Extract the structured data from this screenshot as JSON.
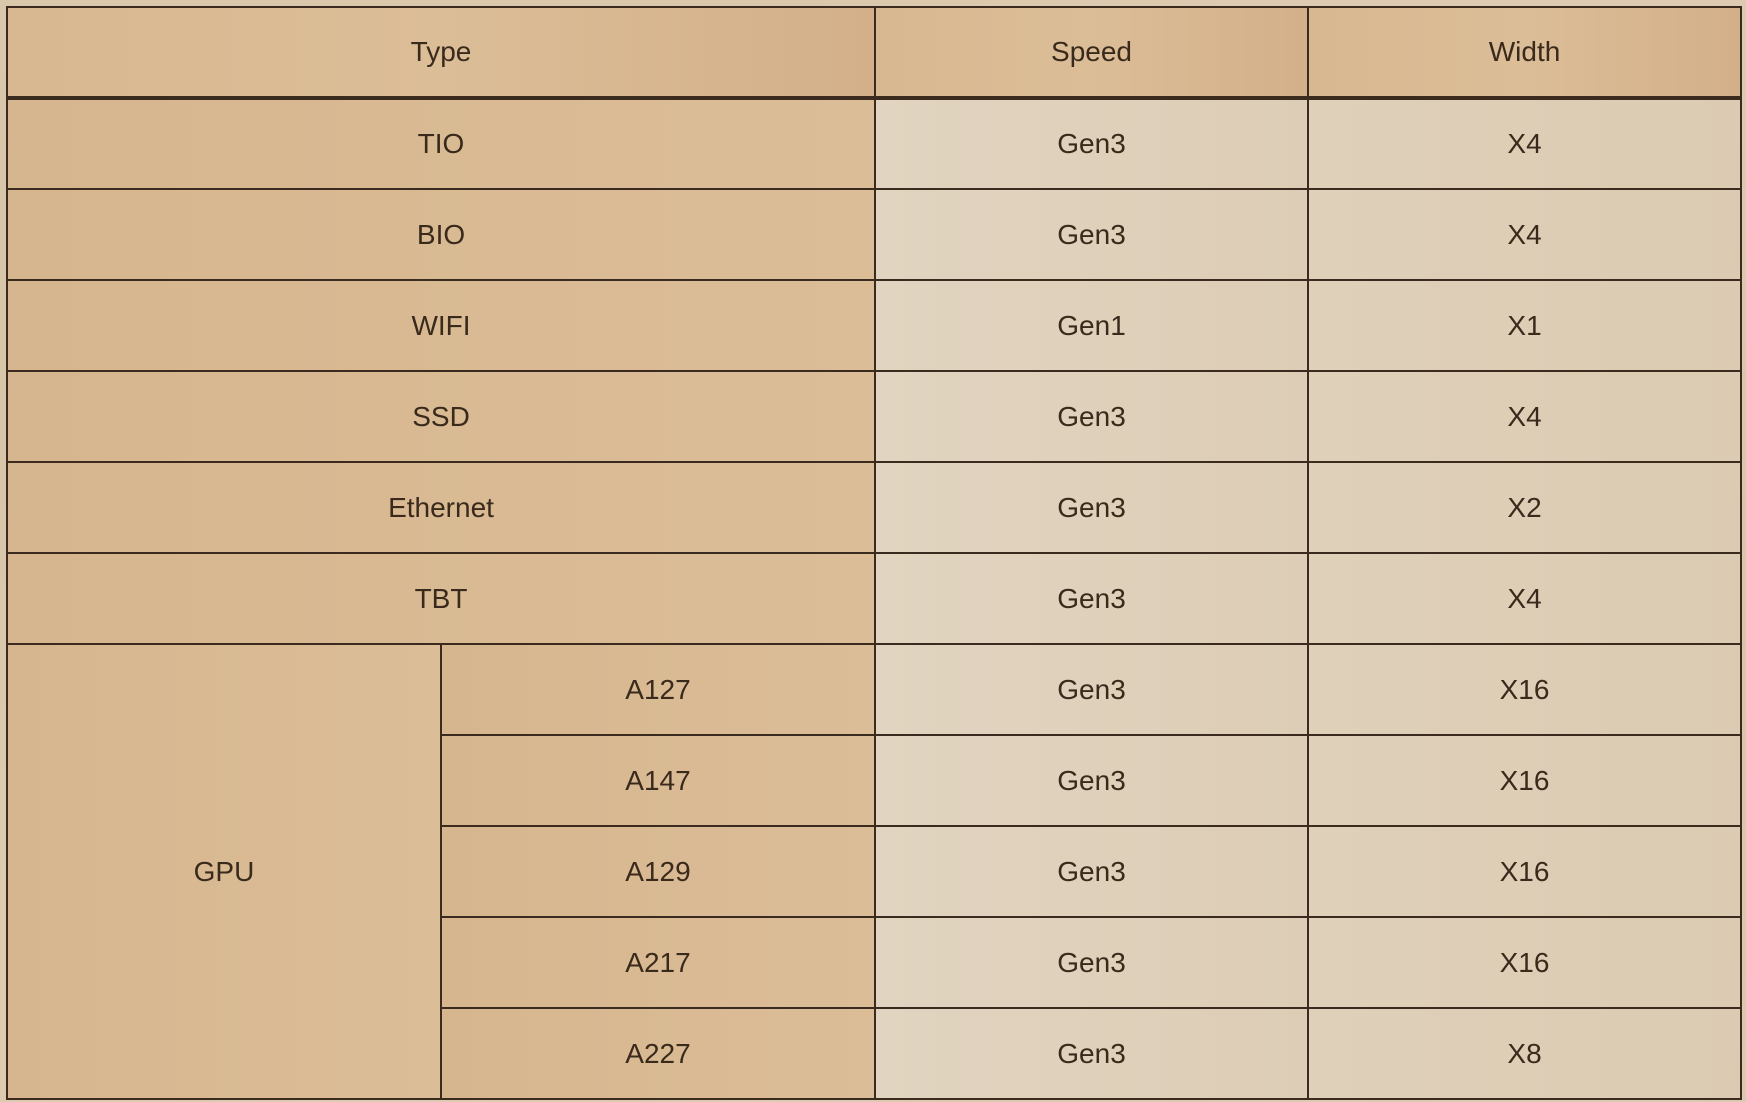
{
  "table": {
    "headers": {
      "type": "Type",
      "speed": "Speed",
      "width": "Width"
    },
    "rows": [
      {
        "type": "TIO",
        "speed": "Gen3",
        "width": "X4"
      },
      {
        "type": "BIO",
        "speed": "Gen3",
        "width": "X4"
      },
      {
        "type": "WIFI",
        "speed": "Gen1",
        "width": "X1"
      },
      {
        "type": "SSD",
        "speed": "Gen3",
        "width": "X4"
      },
      {
        "type": "Ethernet",
        "speed": "Gen3",
        "width": "X2"
      },
      {
        "type": "TBT",
        "speed": "Gen3",
        "width": "X4"
      }
    ],
    "gpu_group": {
      "label": "GPU",
      "rows": [
        {
          "model": "A127",
          "speed": "Gen3",
          "width": "X16"
        },
        {
          "model": "A147",
          "speed": "Gen3",
          "width": "X16"
        },
        {
          "model": "A129",
          "speed": "Gen3",
          "width": "X16"
        },
        {
          "model": "A217",
          "speed": "Gen3",
          "width": "X16"
        },
        {
          "model": "A227",
          "speed": "Gen3",
          "width": "X8"
        }
      ]
    }
  }
}
